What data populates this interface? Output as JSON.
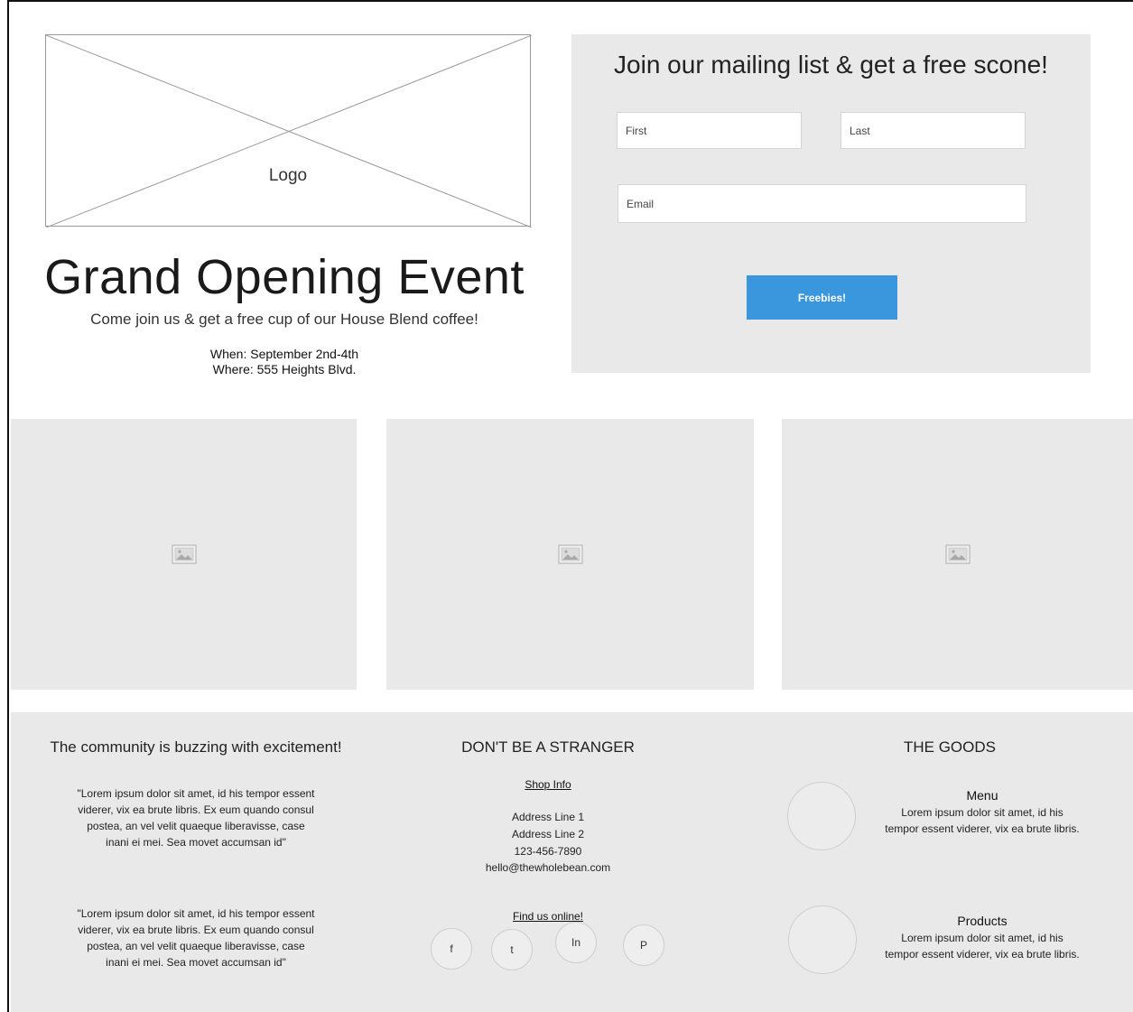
{
  "hero": {
    "logo_label": "Logo",
    "title": "Grand Opening Event",
    "subtitle": "Come join us & get a free cup of our House Blend coffee!",
    "when": "When: September 2nd-4th",
    "where": "Where: 555 Heights Blvd."
  },
  "signup": {
    "title": "Join our mailing list & get a free scone!",
    "first_placeholder": "First",
    "last_placeholder": "Last",
    "email_placeholder": "Email",
    "button_label": "Freebies!",
    "button_color": "#3b97dd"
  },
  "gallery": {
    "tiles": [
      {
        "icon": "image-placeholder-icon"
      },
      {
        "icon": "image-placeholder-icon"
      },
      {
        "icon": "image-placeholder-icon"
      }
    ]
  },
  "footer": {
    "testimonials": {
      "heading": "The community is buzzing with excitement!",
      "quotes": [
        "\"Lorem ipsum dolor sit amet, id his tempor essent viderer, vix ea brute libris. Ex eum quando consul postea, an vel velit quaeque liberavisse, case inani ei mei. Sea movet accumsan id\"",
        "\"Lorem ipsum dolor sit amet, id his tempor essent viderer, vix ea brute libris. Ex eum quando consul postea, an vel velit quaeque liberavisse, case inani ei mei. Sea movet accumsan id\""
      ]
    },
    "contact": {
      "heading": "DON'T BE A STRANGER",
      "shop_info_label": "Shop Info",
      "address_lines": [
        "Address Line 1",
        "Address Line 2",
        "123-456-7890",
        "hello@thewholebean.com"
      ],
      "find_online_label": "Find us online!",
      "socials": [
        "f",
        "t",
        "In",
        "P"
      ]
    },
    "goods": {
      "heading": "THE GOODS",
      "items": [
        {
          "title": "Menu",
          "text": "Lorem ipsum dolor sit amet, id his tempor essent viderer, vix ea brute libris."
        },
        {
          "title": "Products",
          "text": "Lorem ipsum dolor sit amet, id his tempor essent viderer, vix ea brute libris."
        }
      ]
    }
  }
}
